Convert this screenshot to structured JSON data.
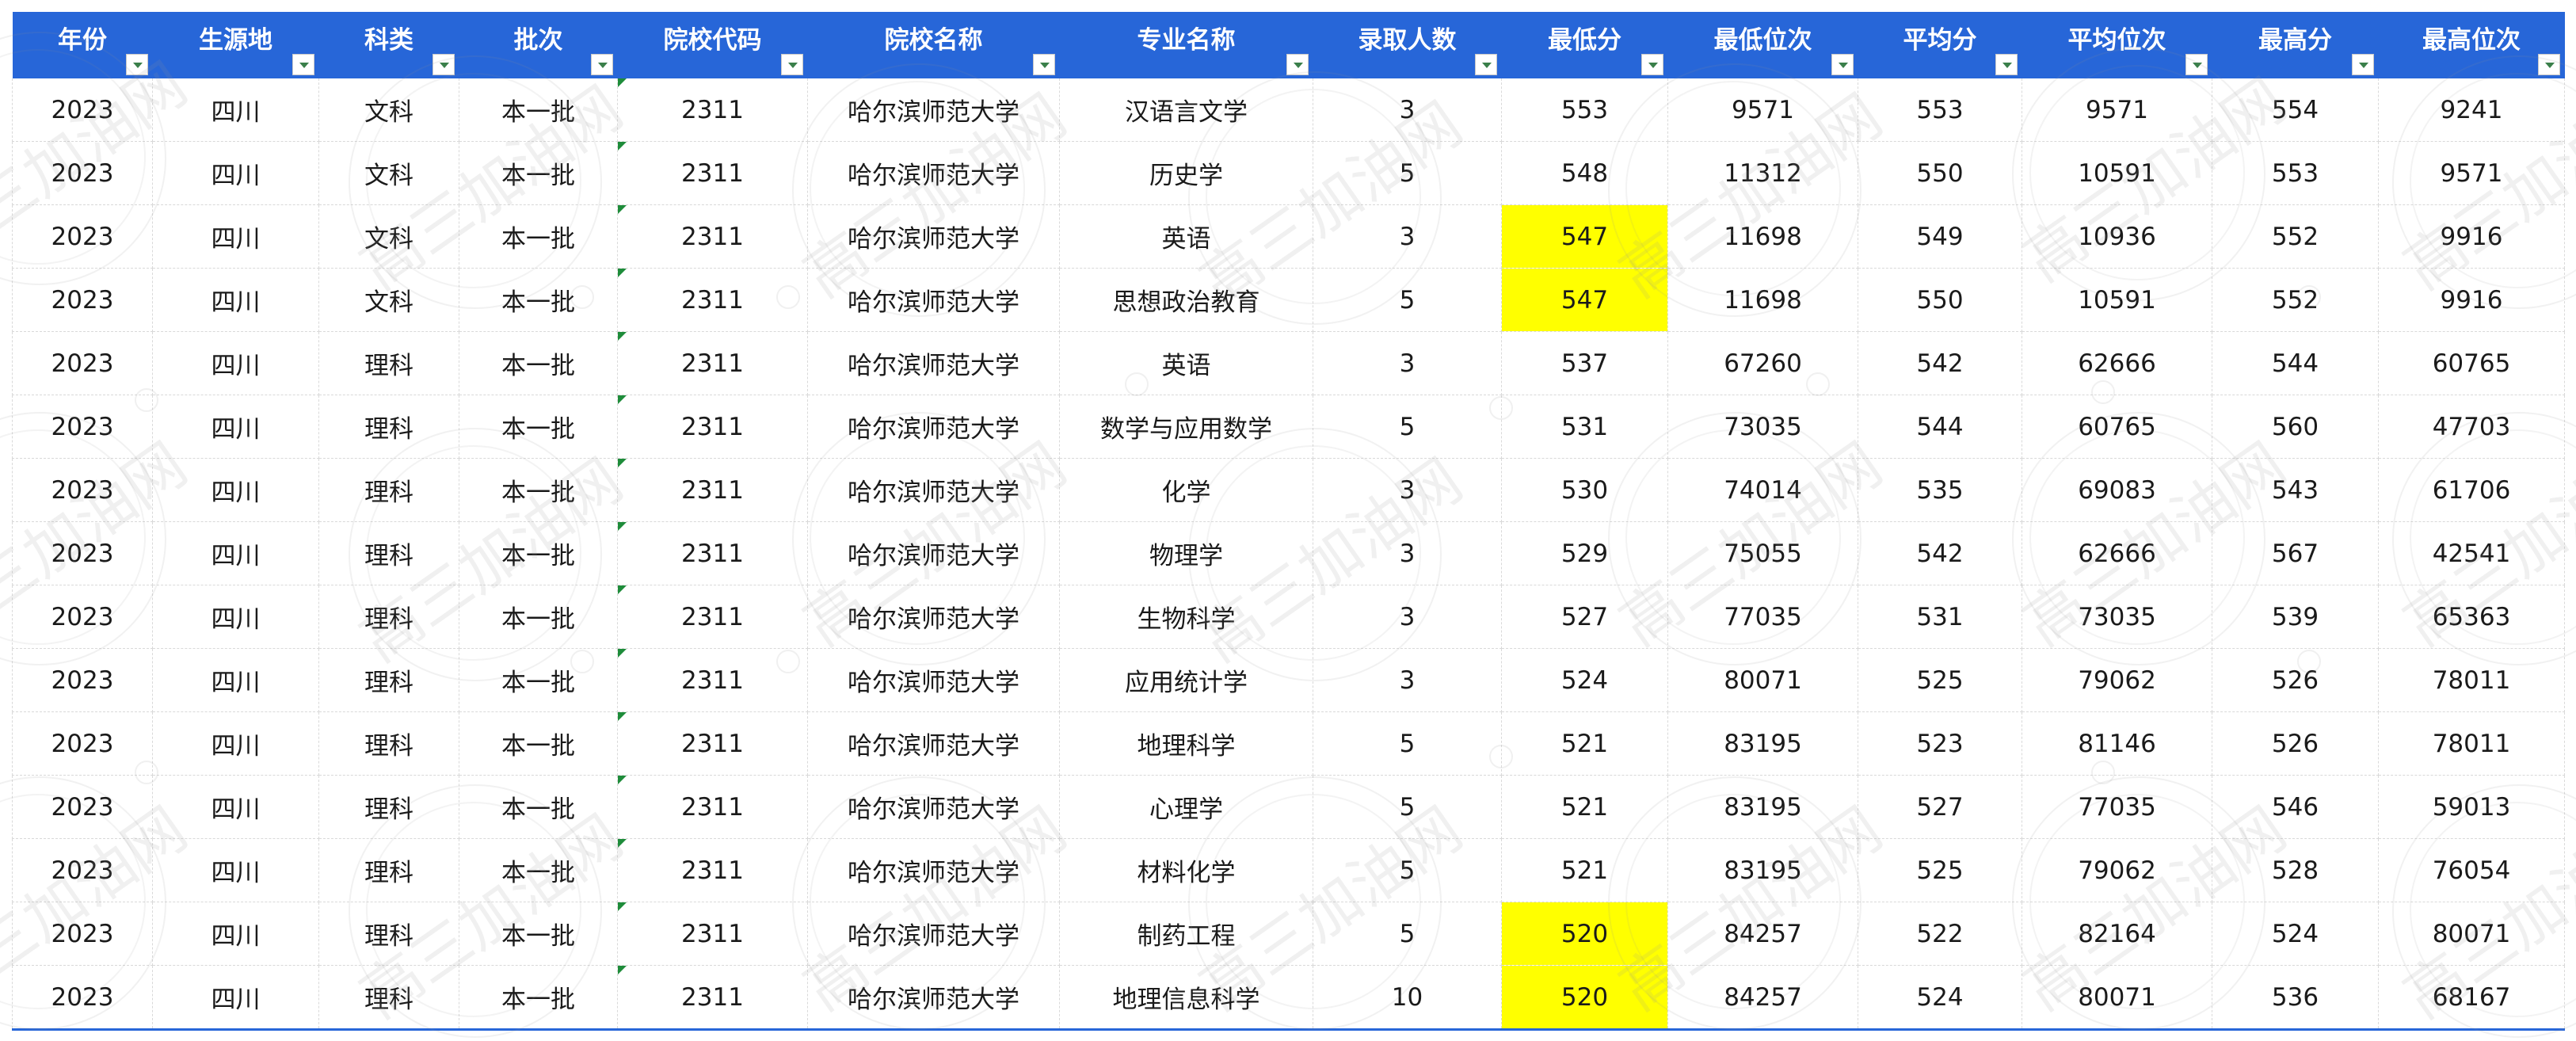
{
  "columns": [
    {
      "label": "年份",
      "key": "year"
    },
    {
      "label": "生源地",
      "key": "origin"
    },
    {
      "label": "科类",
      "key": "category"
    },
    {
      "label": "批次",
      "key": "batch"
    },
    {
      "label": "院校代码",
      "key": "school_code"
    },
    {
      "label": "院校名称",
      "key": "school_name"
    },
    {
      "label": "专业名称",
      "key": "major"
    },
    {
      "label": "录取人数",
      "key": "admitted"
    },
    {
      "label": "最低分",
      "key": "min_score"
    },
    {
      "label": "最低位次",
      "key": "min_rank"
    },
    {
      "label": "平均分",
      "key": "avg_score"
    },
    {
      "label": "平均位次",
      "key": "avg_rank"
    },
    {
      "label": "最高分",
      "key": "max_score"
    },
    {
      "label": "最高位次",
      "key": "max_rank"
    }
  ],
  "highlight_color": "#ffff00",
  "header_color": "#2766d8",
  "watermark_text": "高三加油网",
  "rows": [
    {
      "year": "2023",
      "origin": "四川",
      "category": "文科",
      "batch": "本一批",
      "school_code": "2311",
      "school_name": "哈尔滨师范大学",
      "major": "汉语言文学",
      "admitted": "3",
      "min_score": "553",
      "min_rank": "9571",
      "avg_score": "553",
      "avg_rank": "9571",
      "max_score": "554",
      "max_rank": "9241",
      "highlight_min": false
    },
    {
      "year": "2023",
      "origin": "四川",
      "category": "文科",
      "batch": "本一批",
      "school_code": "2311",
      "school_name": "哈尔滨师范大学",
      "major": "历史学",
      "admitted": "5",
      "min_score": "548",
      "min_rank": "11312",
      "avg_score": "550",
      "avg_rank": "10591",
      "max_score": "553",
      "max_rank": "9571",
      "highlight_min": false
    },
    {
      "year": "2023",
      "origin": "四川",
      "category": "文科",
      "batch": "本一批",
      "school_code": "2311",
      "school_name": "哈尔滨师范大学",
      "major": "英语",
      "admitted": "3",
      "min_score": "547",
      "min_rank": "11698",
      "avg_score": "549",
      "avg_rank": "10936",
      "max_score": "552",
      "max_rank": "9916",
      "highlight_min": true
    },
    {
      "year": "2023",
      "origin": "四川",
      "category": "文科",
      "batch": "本一批",
      "school_code": "2311",
      "school_name": "哈尔滨师范大学",
      "major": "思想政治教育",
      "admitted": "5",
      "min_score": "547",
      "min_rank": "11698",
      "avg_score": "550",
      "avg_rank": "10591",
      "max_score": "552",
      "max_rank": "9916",
      "highlight_min": true
    },
    {
      "year": "2023",
      "origin": "四川",
      "category": "理科",
      "batch": "本一批",
      "school_code": "2311",
      "school_name": "哈尔滨师范大学",
      "major": "英语",
      "admitted": "3",
      "min_score": "537",
      "min_rank": "67260",
      "avg_score": "542",
      "avg_rank": "62666",
      "max_score": "544",
      "max_rank": "60765",
      "highlight_min": false
    },
    {
      "year": "2023",
      "origin": "四川",
      "category": "理科",
      "batch": "本一批",
      "school_code": "2311",
      "school_name": "哈尔滨师范大学",
      "major": "数学与应用数学",
      "admitted": "5",
      "min_score": "531",
      "min_rank": "73035",
      "avg_score": "544",
      "avg_rank": "60765",
      "max_score": "560",
      "max_rank": "47703",
      "highlight_min": false
    },
    {
      "year": "2023",
      "origin": "四川",
      "category": "理科",
      "batch": "本一批",
      "school_code": "2311",
      "school_name": "哈尔滨师范大学",
      "major": "化学",
      "admitted": "3",
      "min_score": "530",
      "min_rank": "74014",
      "avg_score": "535",
      "avg_rank": "69083",
      "max_score": "543",
      "max_rank": "61706",
      "highlight_min": false
    },
    {
      "year": "2023",
      "origin": "四川",
      "category": "理科",
      "batch": "本一批",
      "school_code": "2311",
      "school_name": "哈尔滨师范大学",
      "major": "物理学",
      "admitted": "3",
      "min_score": "529",
      "min_rank": "75055",
      "avg_score": "542",
      "avg_rank": "62666",
      "max_score": "567",
      "max_rank": "42541",
      "highlight_min": false
    },
    {
      "year": "2023",
      "origin": "四川",
      "category": "理科",
      "batch": "本一批",
      "school_code": "2311",
      "school_name": "哈尔滨师范大学",
      "major": "生物科学",
      "admitted": "3",
      "min_score": "527",
      "min_rank": "77035",
      "avg_score": "531",
      "avg_rank": "73035",
      "max_score": "539",
      "max_rank": "65363",
      "highlight_min": false
    },
    {
      "year": "2023",
      "origin": "四川",
      "category": "理科",
      "batch": "本一批",
      "school_code": "2311",
      "school_name": "哈尔滨师范大学",
      "major": "应用统计学",
      "admitted": "3",
      "min_score": "524",
      "min_rank": "80071",
      "avg_score": "525",
      "avg_rank": "79062",
      "max_score": "526",
      "max_rank": "78011",
      "highlight_min": false
    },
    {
      "year": "2023",
      "origin": "四川",
      "category": "理科",
      "batch": "本一批",
      "school_code": "2311",
      "school_name": "哈尔滨师范大学",
      "major": "地理科学",
      "admitted": "5",
      "min_score": "521",
      "min_rank": "83195",
      "avg_score": "523",
      "avg_rank": "81146",
      "max_score": "526",
      "max_rank": "78011",
      "highlight_min": false
    },
    {
      "year": "2023",
      "origin": "四川",
      "category": "理科",
      "batch": "本一批",
      "school_code": "2311",
      "school_name": "哈尔滨师范大学",
      "major": "心理学",
      "admitted": "5",
      "min_score": "521",
      "min_rank": "83195",
      "avg_score": "527",
      "avg_rank": "77035",
      "max_score": "546",
      "max_rank": "59013",
      "highlight_min": false
    },
    {
      "year": "2023",
      "origin": "四川",
      "category": "理科",
      "batch": "本一批",
      "school_code": "2311",
      "school_name": "哈尔滨师范大学",
      "major": "材料化学",
      "admitted": "5",
      "min_score": "521",
      "min_rank": "83195",
      "avg_score": "525",
      "avg_rank": "79062",
      "max_score": "528",
      "max_rank": "76054",
      "highlight_min": false
    },
    {
      "year": "2023",
      "origin": "四川",
      "category": "理科",
      "batch": "本一批",
      "school_code": "2311",
      "school_name": "哈尔滨师范大学",
      "major": "制药工程",
      "admitted": "5",
      "min_score": "520",
      "min_rank": "84257",
      "avg_score": "522",
      "avg_rank": "82164",
      "max_score": "524",
      "max_rank": "80071",
      "highlight_min": true
    },
    {
      "year": "2023",
      "origin": "四川",
      "category": "理科",
      "batch": "本一批",
      "school_code": "2311",
      "school_name": "哈尔滨师范大学",
      "major": "地理信息科学",
      "admitted": "10",
      "min_score": "520",
      "min_rank": "84257",
      "avg_score": "524",
      "avg_rank": "80071",
      "max_score": "536",
      "max_rank": "68167",
      "highlight_min": true
    }
  ]
}
